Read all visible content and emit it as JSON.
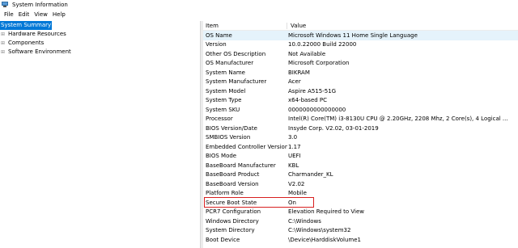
{
  "window": {
    "title": "System Information"
  },
  "menu": [
    "File",
    "Edit",
    "View",
    "Help"
  ],
  "tree": [
    {
      "label": "System Summary",
      "selected": true,
      "expandable": false
    },
    {
      "label": "Hardware Resources",
      "selected": false,
      "expandable": true
    },
    {
      "label": "Components",
      "selected": false,
      "expandable": true
    },
    {
      "label": "Software Environment",
      "selected": false,
      "expandable": true
    }
  ],
  "table": {
    "headers": [
      "Item",
      "Value"
    ],
    "rows": [
      [
        "OS Name",
        "Microsoft Windows 11 Home Single Language"
      ],
      [
        "Version",
        "10.0.22000 Build 22000"
      ],
      [
        "Other OS Description",
        "Not Available"
      ],
      [
        "OS Manufacturer",
        "Microsoft Corporation"
      ],
      [
        "System Name",
        "BIKRAM"
      ],
      [
        "System Manufacturer",
        "Acer"
      ],
      [
        "System Model",
        "Aspire A515-51G"
      ],
      [
        "System Type",
        "x64-based PC"
      ],
      [
        "System SKU",
        "0000000000000000"
      ],
      [
        "Processor",
        "Intel(R) Core(TM) i3-8130U CPU @ 2.20GHz, 2208 Mhz, 2 Core(s), 4 Logical ..."
      ],
      [
        "BIOS Version/Date",
        "Insyde Corp. V2.02, 03-01-2019"
      ],
      [
        "SMBIOS Version",
        "3.0"
      ],
      [
        "Embedded Controller Version",
        "1.17"
      ],
      [
        "BIOS Mode",
        "UEFI"
      ],
      [
        "BaseBoard Manufacturer",
        "KBL"
      ],
      [
        "BaseBoard Product",
        "Charmander_KL"
      ],
      [
        "BaseBoard Version",
        "V2.02"
      ],
      [
        "Platform Role",
        "Mobile"
      ],
      [
        "Secure Boot State",
        "On"
      ],
      [
        "PCR7 Configuration",
        "Elevation Required to View"
      ],
      [
        "Windows Directory",
        "C:\\Windows"
      ],
      [
        "System Directory",
        "C:\\Windows\\system32"
      ],
      [
        "Boot Device",
        "\\Device\\HarddiskVolume1"
      ]
    ],
    "highlighted_row": 0,
    "annotated_row": 18
  },
  "colors": {
    "selection": "#0078d7",
    "row_highlight": "#e5f3fb",
    "annotation": "#d82020"
  },
  "icons": {
    "window": "system-information-icon",
    "expander": "plus-expander-icon"
  }
}
